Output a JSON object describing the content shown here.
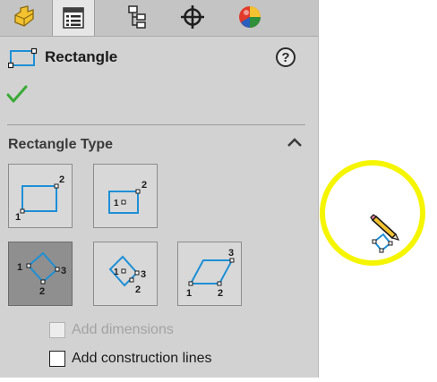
{
  "header": {
    "title": "Rectangle",
    "help_symbol": "?",
    "icon": "rectangle-icon"
  },
  "tabs": [
    {
      "name": "feature-manager",
      "icon": "part-feature-icon",
      "active": false
    },
    {
      "name": "property-manager",
      "icon": "property-list-icon",
      "active": true
    },
    {
      "name": "configuration-manager",
      "icon": "configuration-tree-icon",
      "active": false
    },
    {
      "name": "dimxpert-manager",
      "icon": "crosshair-icon",
      "active": false
    },
    {
      "name": "display-manager",
      "icon": "appearance-ball-icon",
      "active": false
    }
  ],
  "actions": {
    "ok_icon": "green-check-icon"
  },
  "section": {
    "title": "Rectangle Type",
    "collapse_icon": "chevron-up-icon"
  },
  "rectangle_types": [
    {
      "name": "corner-rectangle",
      "labels": [
        "1",
        "2"
      ],
      "selected": false
    },
    {
      "name": "center-rectangle",
      "labels": [
        "1",
        "2"
      ],
      "selected": false
    },
    {
      "name": "3-point-corner-rectangle",
      "labels": [
        "1",
        "2",
        "3"
      ],
      "selected": true
    },
    {
      "name": "3-point-center-rectangle",
      "labels": [
        "1",
        "2",
        "3"
      ],
      "selected": false
    },
    {
      "name": "parallelogram",
      "labels": [
        "1",
        "2",
        "3"
      ],
      "selected": false
    }
  ],
  "options": {
    "add_dimensions": {
      "label": "Add dimensions",
      "checked": false,
      "enabled": false
    },
    "add_construction_lines": {
      "label": "Add construction lines",
      "checked": false,
      "enabled": true
    }
  },
  "canvas": {
    "cursor_icon": "pencil-rectangle-cursor-icon",
    "highlight_color": "#f5f500"
  },
  "colors": {
    "panel_bg": "#d2d2d2",
    "sketch_blue": "#1d8fd6",
    "check_green": "#3aaa35"
  }
}
